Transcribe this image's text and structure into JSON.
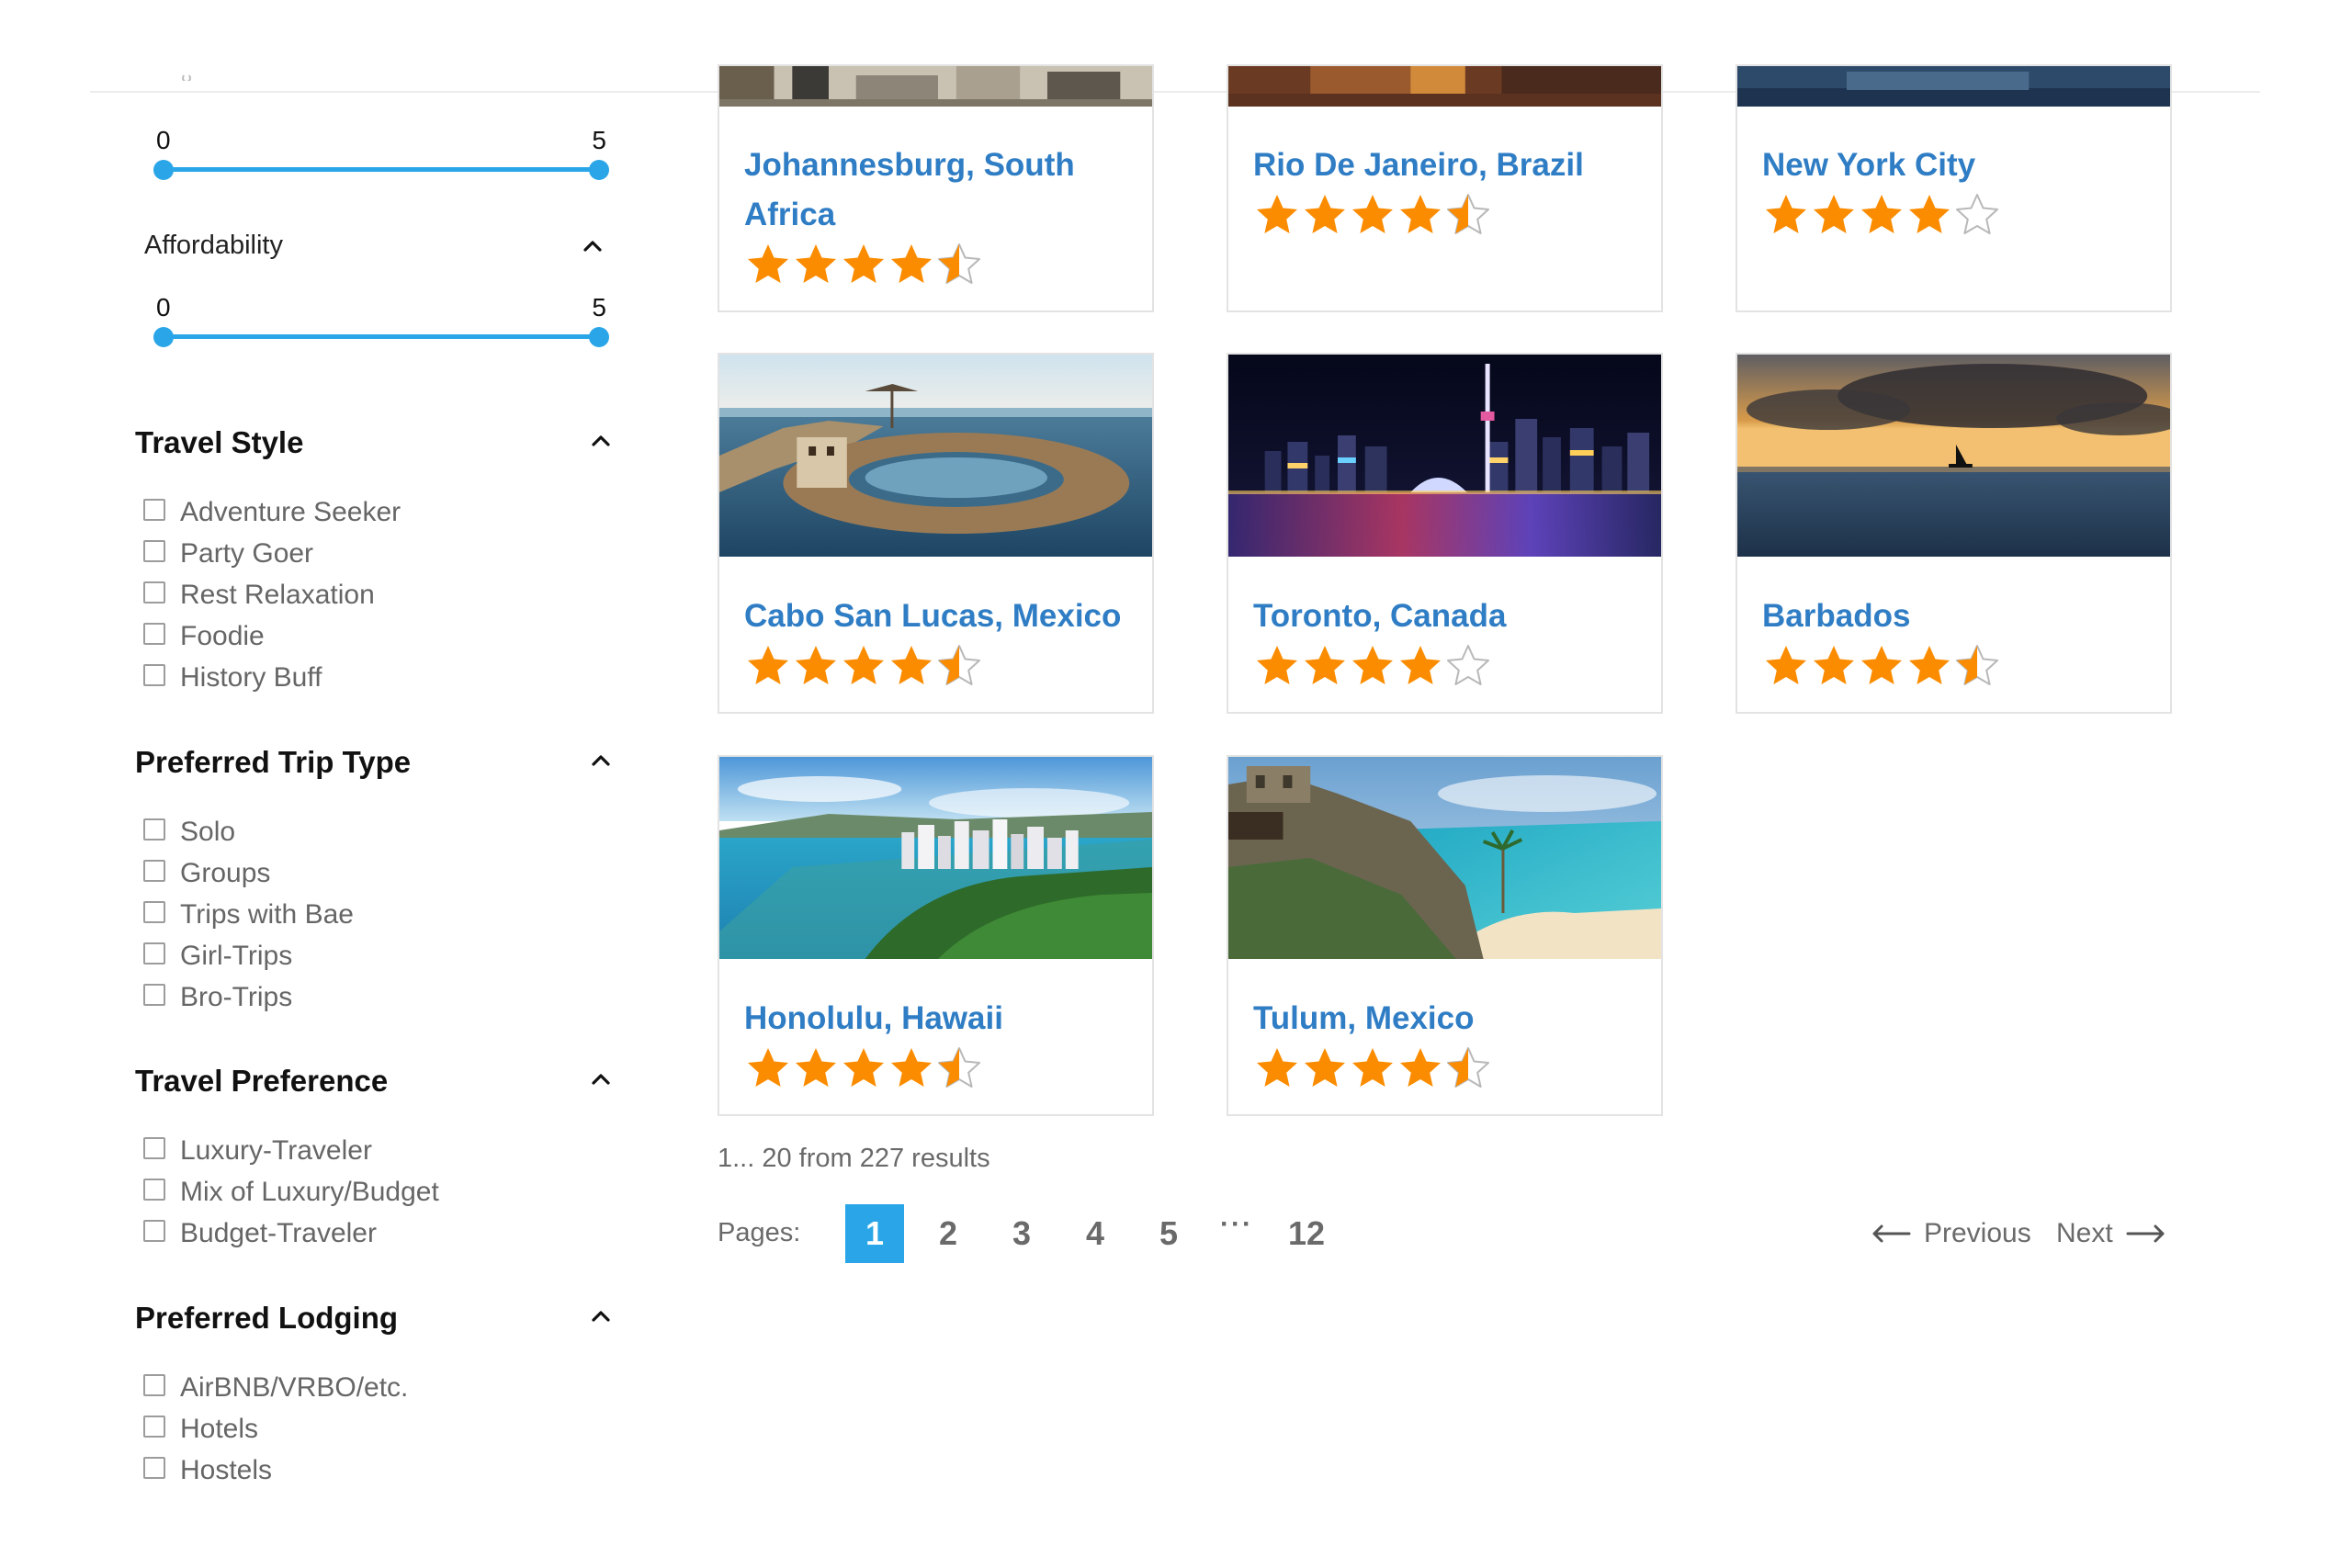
{
  "filters": {
    "rating_range": {
      "min": "0",
      "max": "5"
    },
    "affordability": {
      "title": "Affordability",
      "min": "0",
      "max": "5"
    },
    "groups": [
      {
        "title": "Travel Style",
        "options": [
          "Adventure Seeker",
          "Party Goer",
          "Rest Relaxation",
          "Foodie",
          "History Buff"
        ]
      },
      {
        "title": "Preferred Trip Type",
        "options": [
          "Solo",
          "Groups",
          "Trips with Bae",
          "Girl-Trips",
          "Bro-Trips"
        ]
      },
      {
        "title": "Travel Preference",
        "options": [
          "Luxury-Traveler",
          "Mix of Luxury/Budget",
          "Budget-Traveler"
        ]
      },
      {
        "title": "Preferred Lodging",
        "options": [
          "AirBNB/VRBO/etc.",
          "Hotels",
          "Hostels"
        ]
      }
    ]
  },
  "destinations": [
    {
      "name": "Johannesburg, South Africa",
      "rating": 4.5
    },
    {
      "name": "Rio De Janeiro, Brazil",
      "rating": 4.5
    },
    {
      "name": "New York City",
      "rating": 4
    },
    {
      "name": "Cabo San Lucas, Mexico",
      "rating": 4.5
    },
    {
      "name": "Toronto, Canada",
      "rating": 4
    },
    {
      "name": "Barbados",
      "rating": 4.5
    },
    {
      "name": "Honolulu, Hawaii",
      "rating": 4.5
    },
    {
      "name": "Tulum, Mexico",
      "rating": 4.5
    }
  ],
  "results": {
    "summary": "1... 20 from 227 results",
    "pages_label": "Pages:",
    "pages": [
      "1",
      "2",
      "3",
      "4",
      "5",
      "···",
      "12"
    ],
    "current_page": "1",
    "previous": "Previous",
    "next": "Next"
  },
  "colors": {
    "accent": "#2aa6e8",
    "link": "#2f7dc4",
    "star": "#fb8c00"
  },
  "icons": {
    "collapse": "chevron-up-icon",
    "rating": "star-icon",
    "prev": "arrow-left-icon",
    "next": "arrow-right-icon"
  }
}
